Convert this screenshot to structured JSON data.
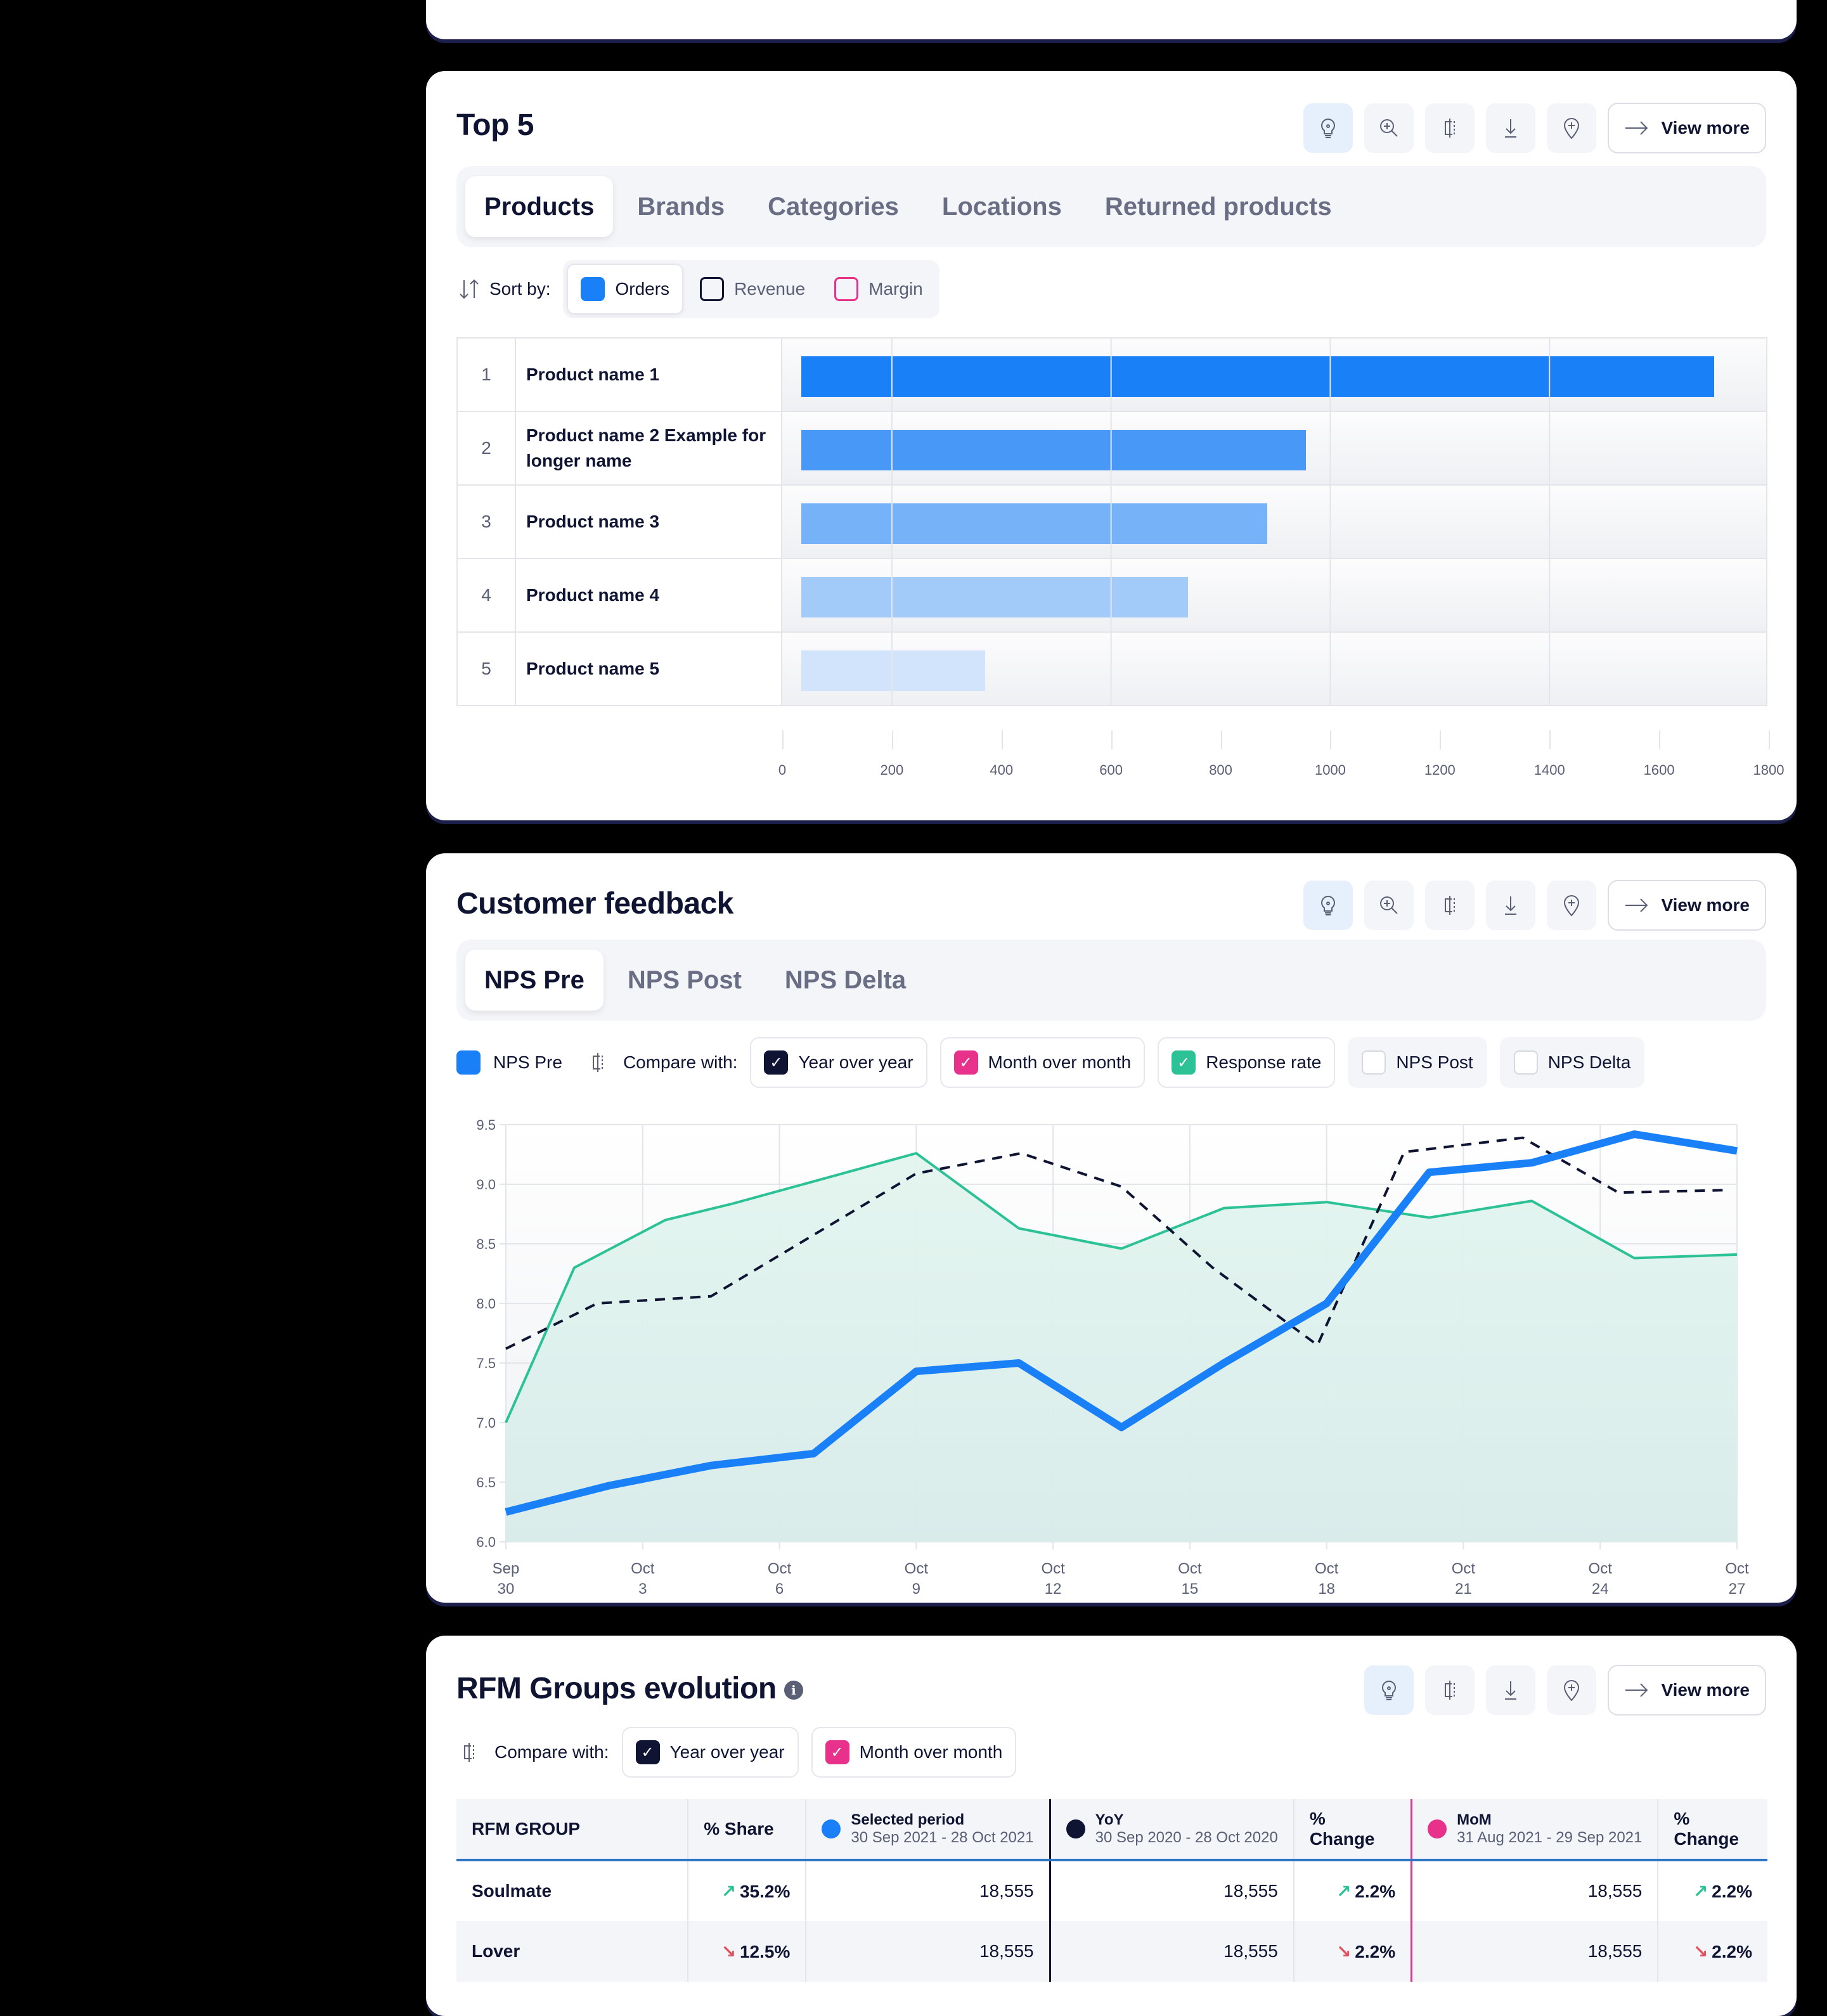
{
  "top5": {
    "title": "Top 5",
    "view_more": "View more",
    "tabs": [
      {
        "label": "Products",
        "active": true
      },
      {
        "label": "Brands",
        "active": false
      },
      {
        "label": "Categories",
        "active": false
      },
      {
        "label": "Locations",
        "active": false
      },
      {
        "label": "Returned products",
        "active": false
      }
    ],
    "sort_label": "Sort by:",
    "sort_options": [
      {
        "label": "Orders",
        "active": true,
        "color": "#1a80f8"
      },
      {
        "label": "Revenue",
        "active": false,
        "color": "#0f1433"
      },
      {
        "label": "Margin",
        "active": false,
        "color": "#e8318a"
      }
    ],
    "rows": [
      {
        "rank": "1",
        "name": "Product name 1"
      },
      {
        "rank": "2",
        "name": "Product name 2 Example for longer name"
      },
      {
        "rank": "3",
        "name": "Product name 3"
      },
      {
        "rank": "4",
        "name": "Product name 4"
      },
      {
        "rank": "5",
        "name": "Product name 5"
      }
    ]
  },
  "feedback": {
    "title": "Customer feedback",
    "view_more": "View more",
    "tabs": [
      {
        "label": "NPS Pre",
        "active": true
      },
      {
        "label": "NPS Post",
        "active": false
      },
      {
        "label": "NPS Delta",
        "active": false
      }
    ],
    "legend_main": "NPS Pre",
    "compare_label": "Compare with:",
    "compare_options": [
      {
        "label": "Year over year",
        "checked": true,
        "color": "#0f1433"
      },
      {
        "label": "Month over month",
        "checked": true,
        "color": "#e8318a"
      },
      {
        "label": "Response rate",
        "checked": true,
        "color": "#2cc296"
      },
      {
        "label": "NPS Post",
        "checked": false,
        "color": "#ffffff"
      },
      {
        "label": "NPS Delta",
        "checked": false,
        "color": "#ffffff"
      }
    ]
  },
  "rfm": {
    "title": "RFM Groups evolution",
    "view_more": "View more",
    "compare_label": "Compare with:",
    "compare_options": [
      {
        "label": "Year over year",
        "checked": true,
        "color": "#0f1433"
      },
      {
        "label": "Month over month",
        "checked": true,
        "color": "#e8318a"
      }
    ],
    "headers": {
      "group": "RFM GROUP",
      "share": "% Share",
      "selected_title": "Selected period",
      "selected_range": "30 Sep 2021 - 28 Oct 2021",
      "yoy_title": "YoY",
      "yoy_range": "30 Sep 2020 - 28 Oct 2020",
      "change": "% Change",
      "mom_title": "MoM",
      "mom_range": "31 Aug  2021 - 29 Sep 2021",
      "change2": "% Change"
    },
    "rows": [
      {
        "group": "Soulmate",
        "share": "35.2%",
        "share_dir": "up",
        "selected": "18,555",
        "yoy": "18,555",
        "yoy_change": "2.2%",
        "yoy_dir": "up",
        "mom": "18,555",
        "mom_change": "2.2%",
        "mom_dir": "up"
      },
      {
        "group": "Lover",
        "share": "12.5%",
        "share_dir": "down",
        "selected": "18,555",
        "yoy": "18,555",
        "yoy_change": "2.2%",
        "yoy_dir": "down",
        "mom": "18,555",
        "mom_change": "2.2%",
        "mom_dir": "down"
      }
    ],
    "colors": {
      "selected": "#1a80f8",
      "yoy": "#0f1433",
      "mom": "#e8318a"
    }
  },
  "chart_data": [
    {
      "type": "bar",
      "orientation": "horizontal",
      "title": "Top 5",
      "categories": [
        "Product name 1",
        "Product name 2 Example for longer name",
        "Product name 3",
        "Product name 4",
        "Product name 5"
      ],
      "values": [
        1700,
        955,
        885,
        740,
        370
      ],
      "colors": [
        "#1a80f8",
        "#4899f7",
        "#75b2f8",
        "#a2cbfa",
        "#d2e4fb"
      ],
      "xlim": [
        0,
        1800
      ],
      "xticks": [
        "0",
        "200",
        "400",
        "600",
        "800",
        "1000",
        "1200",
        "1400",
        "1600",
        "1800"
      ],
      "grid": true
    },
    {
      "type": "line",
      "title": "Customer feedback",
      "ylim": [
        6.0,
        9.5
      ],
      "yticks": [
        "6.0",
        "6.5",
        "7.0",
        "7.5",
        "8.0",
        "8.5",
        "9.0",
        "9.5"
      ],
      "xticks": [
        [
          "Sep",
          "30"
        ],
        [
          "Oct",
          "3"
        ],
        [
          "Oct",
          "6"
        ],
        [
          "Oct",
          "9"
        ],
        [
          "Oct",
          "12"
        ],
        [
          "Oct",
          "15"
        ],
        [
          "Oct",
          "18"
        ],
        [
          "Oct",
          "21"
        ],
        [
          "Oct",
          "24"
        ],
        [
          "Oct",
          "27"
        ]
      ],
      "x_range_days": [
        0,
        27
      ],
      "grid": true,
      "series": [
        {
          "name": "Response rate",
          "style": "area",
          "color": "#2cc296",
          "x": [
            0,
            1.5,
            3.5,
            5,
            9,
            11.25,
            13.5,
            15.75,
            18,
            20.25,
            22.5,
            24.75,
            27
          ],
          "values": [
            7.0,
            8.3,
            8.7,
            8.84,
            9.26,
            8.63,
            8.46,
            8.8,
            8.85,
            8.72,
            8.86,
            8.38,
            8.41
          ]
        },
        {
          "name": "Year over year",
          "style": "dashed",
          "color": "#0f1433",
          "x": [
            0,
            2,
            4.5,
            9,
            11.3,
            13.5,
            15.5,
            17.8,
            19.7,
            22.3,
            24.4,
            26.7
          ],
          "values": [
            7.62,
            8.0,
            8.06,
            9.09,
            9.26,
            8.98,
            8.3,
            7.65,
            9.27,
            9.39,
            8.93,
            8.95
          ]
        },
        {
          "name": "NPS Pre",
          "style": "thick",
          "color": "#1a80f8",
          "x": [
            0,
            2.25,
            4.5,
            6.75,
            9,
            11.25,
            13.5,
            15.75,
            18,
            20.25,
            22.5,
            24.75,
            27
          ],
          "values": [
            6.25,
            6.47,
            6.64,
            6.74,
            7.43,
            7.5,
            6.96,
            7.5,
            8.0,
            9.1,
            9.18,
            9.42,
            9.28
          ]
        }
      ]
    }
  ]
}
